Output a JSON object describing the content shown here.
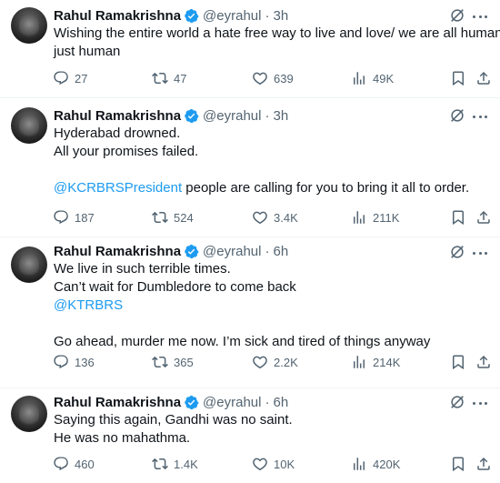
{
  "colors": {
    "accent": "#1d9bf0",
    "text": "#0f1419",
    "muted": "#536471",
    "divider": "#eff3f4"
  },
  "icons": [
    "verified-badge-icon",
    "grok-icon",
    "more-icon",
    "reply-icon",
    "retweet-icon",
    "like-icon",
    "views-icon",
    "bookmark-icon",
    "share-icon"
  ],
  "tweets": [
    {
      "name": "Rahul Ramakrishna",
      "handle": "@eyrahul",
      "dot": "·",
      "time": "3h",
      "lines": [
        "Wishing the entire world a hate free way to live and love/ we are all human",
        "just human"
      ],
      "replies": "27",
      "retweets": "47",
      "likes": "639",
      "views": "49K"
    },
    {
      "name": "Rahul Ramakrishna",
      "handle": "@eyrahul",
      "dot": "·",
      "time": "3h",
      "lines": [
        "Hyderabad drowned.",
        "All your promises failed.",
        "",
        " people are calling for you to bring it all to order."
      ],
      "mention": "@KCRBRSPresident",
      "replies": "187",
      "retweets": "524",
      "likes": "3.4K",
      "views": "211K"
    },
    {
      "name": "Rahul Ramakrishna",
      "handle": "@eyrahul",
      "dot": "·",
      "time": "6h",
      "lines": [
        "We live in such terrible times.",
        "Can’t wait for Dumbledore to come back",
        "",
        "",
        "Go ahead, murder me now. I’m sick and tired of things anyway"
      ],
      "mention": "@KTRBRS",
      "replies": "136",
      "retweets": "365",
      "likes": "2.2K",
      "views": "214K"
    },
    {
      "name": "Rahul Ramakrishna",
      "handle": "@eyrahul",
      "dot": "·",
      "time": "6h",
      "lines": [
        "Saying this again, Gandhi was no saint.",
        "He was no mahathma."
      ],
      "replies": "460",
      "retweets": "1.4K",
      "likes": "10K",
      "views": "420K"
    }
  ]
}
